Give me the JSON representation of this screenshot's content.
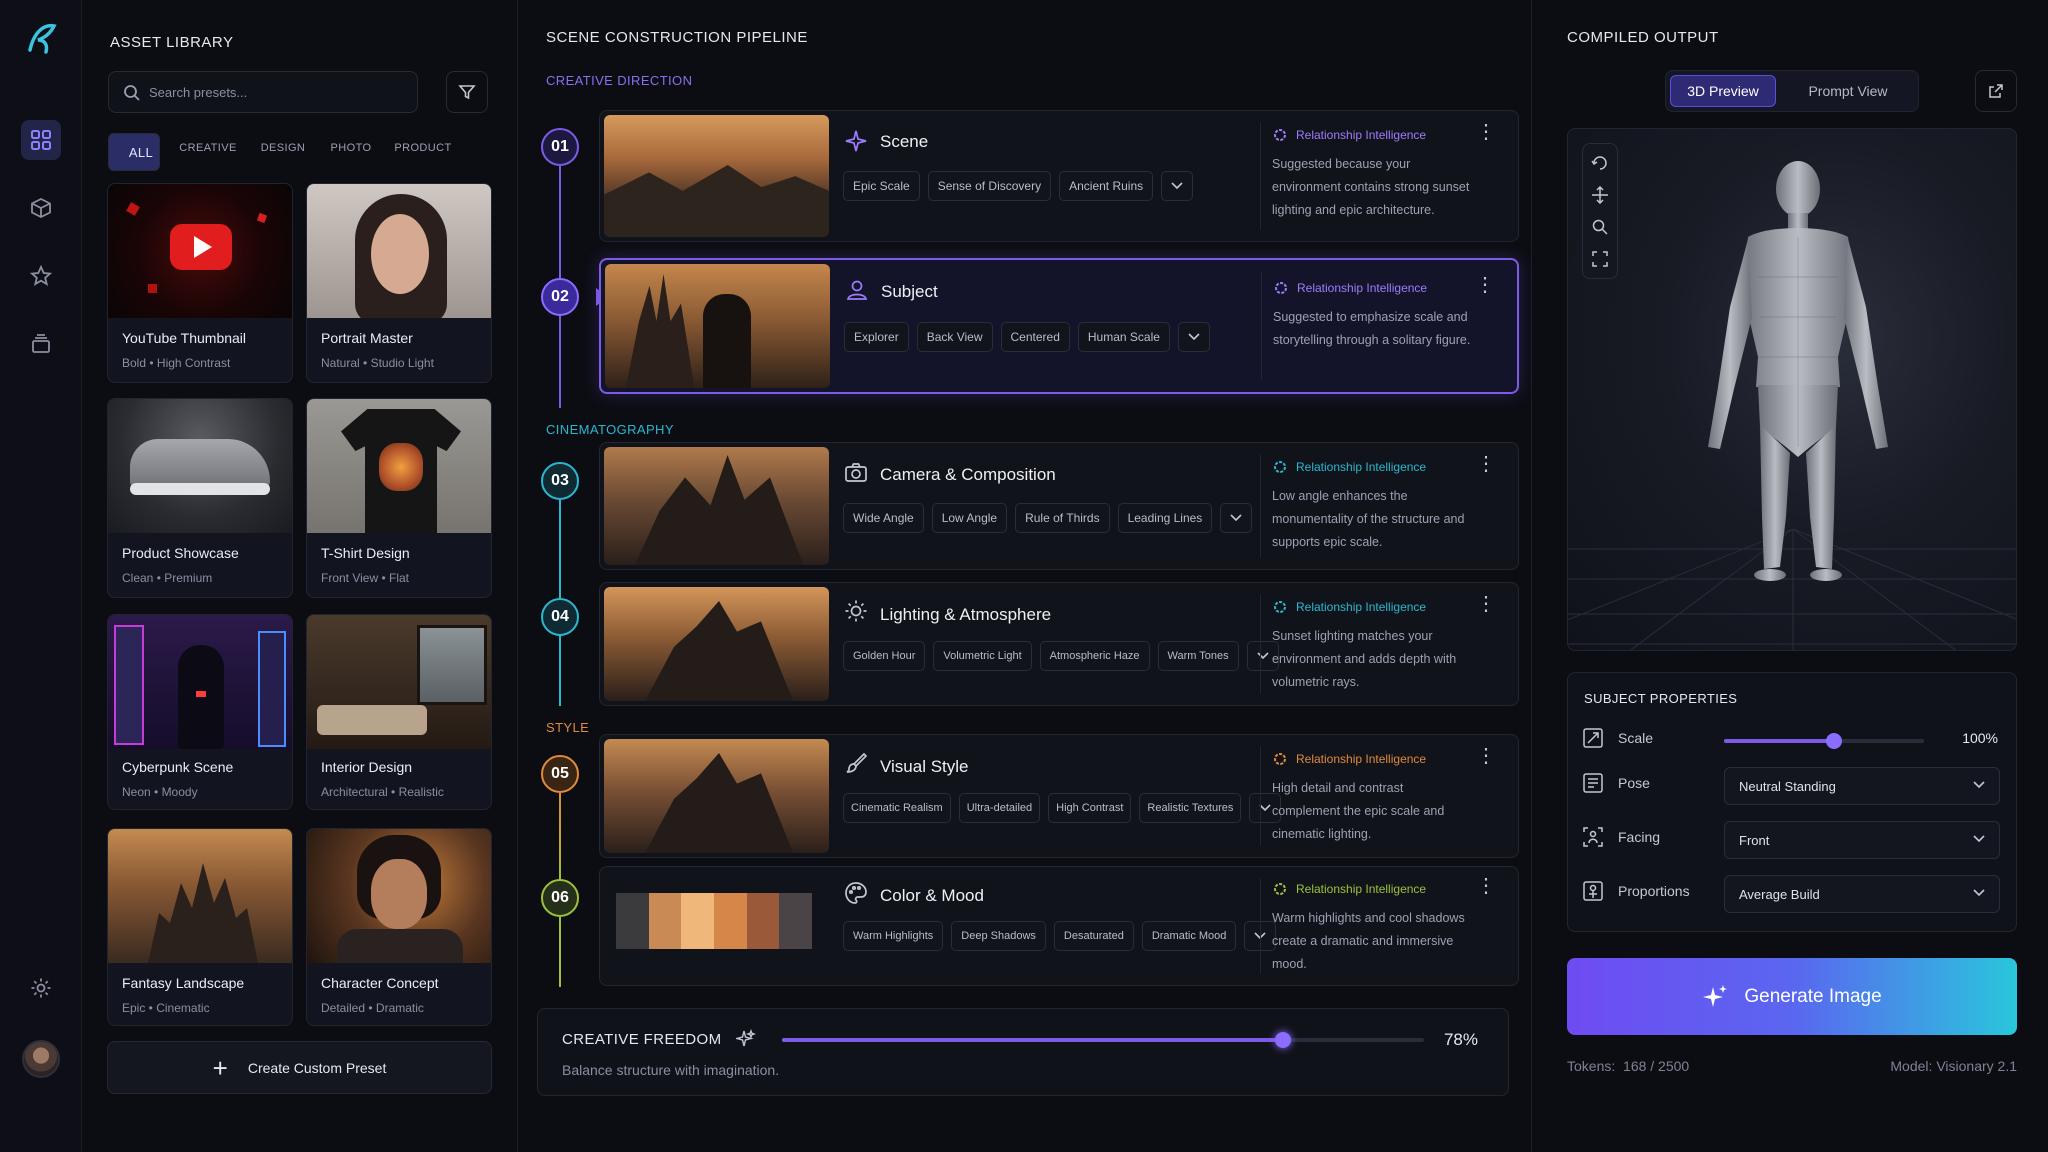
{
  "asset_library": {
    "title": "ASSET LIBRARY",
    "search_placeholder": "Search presets...",
    "categories": [
      "ALL",
      "CREATIVE",
      "DESIGN",
      "PHOTO",
      "PRODUCT"
    ],
    "cards": [
      {
        "title": "YouTube Thumbnail",
        "sub1": "Bold",
        "sub2": "High Contrast"
      },
      {
        "title": "Portrait Master",
        "sub1": "Natural",
        "sub2": "Studio Light"
      },
      {
        "title": "Product Showcase",
        "sub1": "Clean",
        "sub2": "Premium"
      },
      {
        "title": "T-Shirt Design",
        "sub1": "Front View",
        "sub2": "Flat"
      },
      {
        "title": "Cyberpunk Scene",
        "sub1": "Neon",
        "sub2": "Moody"
      },
      {
        "title": "Interior Design",
        "sub1": "Architectural",
        "sub2": "Realistic"
      },
      {
        "title": "Fantasy Landscape",
        "sub1": "Epic",
        "sub2": "Cinematic"
      },
      {
        "title": "Character Concept",
        "sub1": "Detailed",
        "sub2": "Dramatic"
      }
    ],
    "create_label": "Create Custom Preset"
  },
  "pipeline": {
    "title": "SCENE CONSTRUCTION PIPELINE",
    "sections": {
      "creative": "CREATIVE DIRECTION",
      "cine": "CINEMATOGRAPHY",
      "style": "STYLE"
    },
    "ri_label": "Relationship Intelligence",
    "steps": [
      {
        "num": "01",
        "title": "Scene",
        "tags": [
          "Epic Scale",
          "Sense of Discovery",
          "Ancient Ruins"
        ],
        "text": "Suggested because your environment contains strong sunset lighting and epic architecture."
      },
      {
        "num": "02",
        "title": "Subject",
        "tags": [
          "Explorer",
          "Back View",
          "Centered",
          "Human Scale"
        ],
        "text": "Suggested to emphasize scale and storytelling through a solitary figure."
      },
      {
        "num": "03",
        "title": "Camera & Composition",
        "tags": [
          "Wide Angle",
          "Low Angle",
          "Rule of Thirds",
          "Leading Lines"
        ],
        "text": "Low angle enhances the monumentality of the structure and supports epic scale."
      },
      {
        "num": "04",
        "title": "Lighting & Atmosphere",
        "tags": [
          "Golden Hour",
          "Volumetric Light",
          "Atmospheric Haze",
          "Warm Tones"
        ],
        "text": "Sunset lighting matches your environment and adds depth with volumetric rays."
      },
      {
        "num": "05",
        "title": "Visual Style",
        "tags": [
          "Cinematic Realism",
          "Ultra-detailed",
          "High Contrast",
          "Realistic Textures"
        ],
        "text": "High detail and contrast complement the epic scale and cinematic lighting."
      },
      {
        "num": "06",
        "title": "Color & Mood",
        "tags": [
          "Warm Highlights",
          "Deep Shadows",
          "Desaturated",
          "Dramatic Mood"
        ],
        "text": "Warm highlights and cool shadows create a dramatic and immersive mood."
      }
    ],
    "palette": [
      "#3b3a3d",
      "#c98a55",
      "#f0b77a",
      "#d7864a",
      "#9a5a3a",
      "#4a4446"
    ],
    "freedom": {
      "title": "CREATIVE FREEDOM",
      "value": "78%",
      "value_fraction": 0.78,
      "subtitle": "Balance structure with imagination."
    }
  },
  "output": {
    "title": "COMPILED OUTPUT",
    "tabs": [
      "3D Preview",
      "Prompt View"
    ],
    "props_title": "SUBJECT PROPERTIES",
    "scale_label": "Scale",
    "scale_value": "100%",
    "scale_fraction": 0.55,
    "pose_label": "Pose",
    "pose_value": "Neutral Standing",
    "facing_label": "Facing",
    "facing_value": "Front",
    "proportions_label": "Proportions",
    "proportions_value": "Average Build",
    "generate_label": "Generate Image",
    "tokens_label": "Tokens:",
    "tokens_value": "168 / 2500",
    "model_label": "Model:",
    "model_value": "Visionary 2.1"
  },
  "colors": {
    "accent": "#7c5ce6",
    "cinematography": "#2bb7cf",
    "style": "#e08a3a",
    "mood": "#9bc23a"
  }
}
